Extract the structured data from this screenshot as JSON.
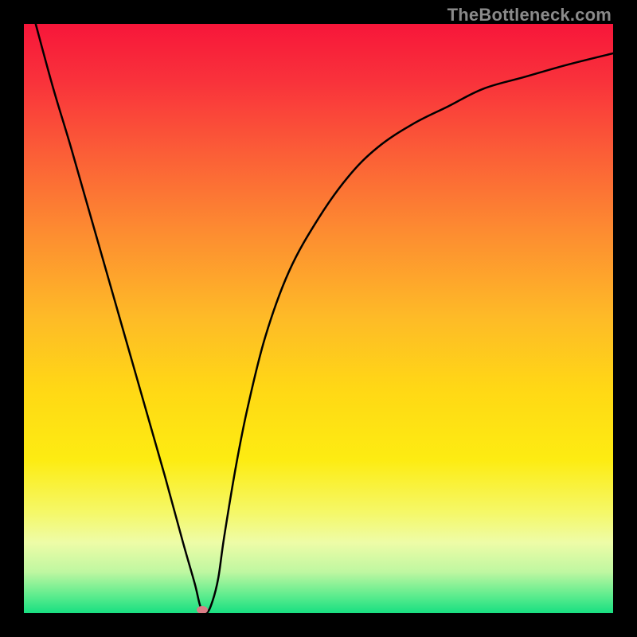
{
  "watermark": "TheBottleneck.com",
  "gradient": {
    "stops": [
      {
        "offset": 0.0,
        "color": "#f7163a"
      },
      {
        "offset": 0.1,
        "color": "#f9333b"
      },
      {
        "offset": 0.22,
        "color": "#fb5e37"
      },
      {
        "offset": 0.35,
        "color": "#fd8b31"
      },
      {
        "offset": 0.5,
        "color": "#febb27"
      },
      {
        "offset": 0.62,
        "color": "#ffd815"
      },
      {
        "offset": 0.74,
        "color": "#fdec12"
      },
      {
        "offset": 0.83,
        "color": "#f5f869"
      },
      {
        "offset": 0.88,
        "color": "#eefca7"
      },
      {
        "offset": 0.93,
        "color": "#bff7a1"
      },
      {
        "offset": 0.97,
        "color": "#5eec8e"
      },
      {
        "offset": 1.0,
        "color": "#18df81"
      }
    ]
  },
  "chart_data": {
    "type": "line",
    "title": "",
    "xlabel": "",
    "ylabel": "",
    "xlim": [
      0,
      100
    ],
    "ylim": [
      0,
      100
    ],
    "series": [
      {
        "name": "curve",
        "x": [
          2,
          5,
          8,
          12,
          16,
          20,
          24,
          27,
          29,
          30,
          31,
          32,
          33,
          34,
          36,
          38,
          41,
          45,
          50,
          55,
          60,
          66,
          72,
          78,
          85,
          92,
          100
        ],
        "y": [
          100,
          89,
          79,
          65,
          51,
          37,
          23,
          12,
          5,
          1,
          0,
          2,
          6,
          13,
          25,
          35,
          47,
          58,
          67,
          74,
          79,
          83,
          86,
          89,
          91,
          93,
          95
        ]
      }
    ],
    "marker": {
      "x": 30.3,
      "y": 0.5
    },
    "note": "x and y are percentages of the plot area; y=0 at bottom, y=100 at top"
  }
}
